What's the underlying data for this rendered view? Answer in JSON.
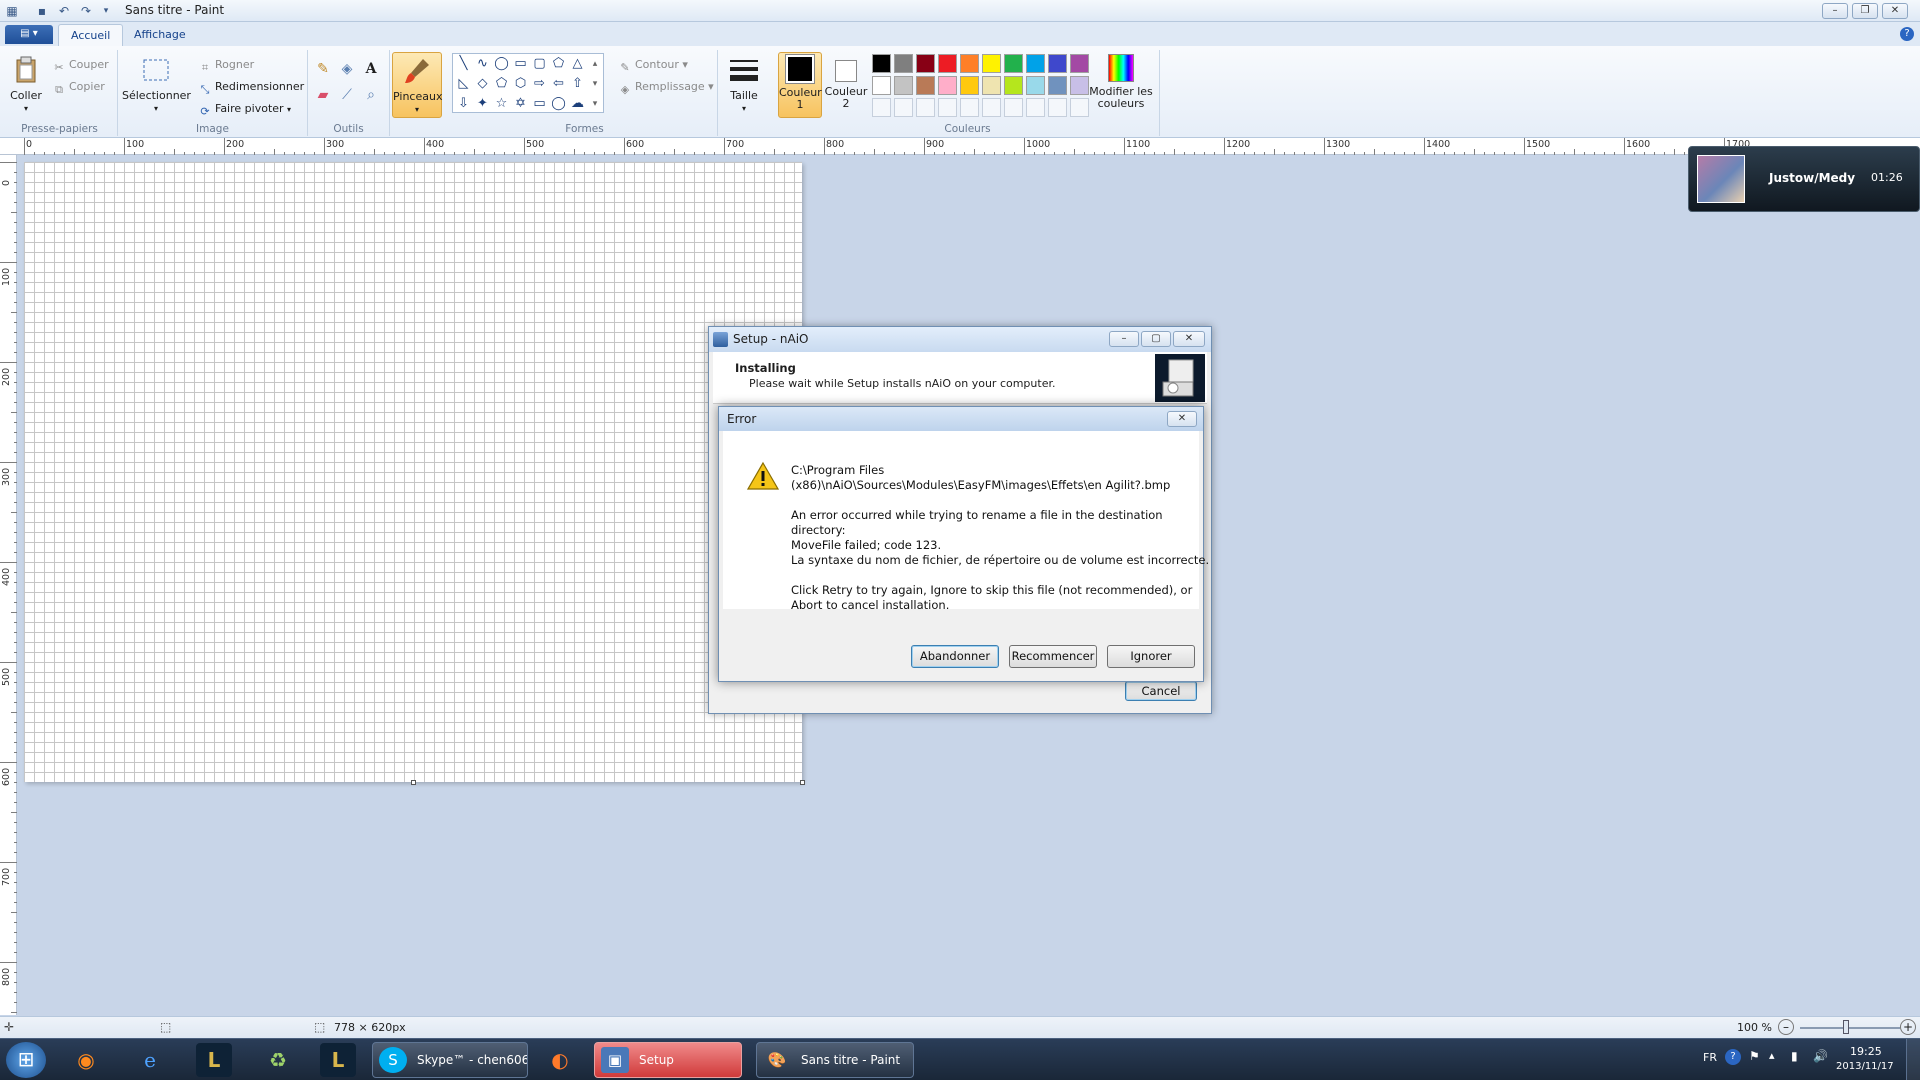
{
  "window": {
    "title": "Sans titre - Paint"
  },
  "ribbon": {
    "file_label": "▤ ▾",
    "tabs": [
      "Accueil",
      "Affichage"
    ],
    "clipboard": {
      "paste": "Coller",
      "cut": "Couper",
      "copy": "Copier",
      "group": "Presse-papiers"
    },
    "image": {
      "select": "Sélectionner",
      "crop": "Rogner",
      "resize": "Redimensionner",
      "rotate": "Faire pivoter",
      "group": "Image"
    },
    "tools": {
      "group": "Outils"
    },
    "brushes": {
      "label": "Pinceaux"
    },
    "shapes": {
      "outline": "Contour",
      "fill": "Remplissage",
      "group": "Formes"
    },
    "size": {
      "label": "Taille"
    },
    "colors": {
      "color1_line1": "Couleur",
      "color1_line2": "1",
      "color2_line1": "Couleur",
      "color2_line2": "2",
      "edit_line1": "Modifier les",
      "edit_line2": "couleurs",
      "group": "Couleurs",
      "palette_row1": [
        "#000000",
        "#7f7f7f",
        "#880015",
        "#ed1c24",
        "#ff7f27",
        "#fff200",
        "#22b14c",
        "#00a2e8",
        "#3f48cc",
        "#a349a4"
      ],
      "palette_row2": [
        "#ffffff",
        "#c3c3c3",
        "#b97a57",
        "#ffaec9",
        "#ffc90e",
        "#efe4b0",
        "#b5e61d",
        "#99d9ea",
        "#7092be",
        "#c8bfe7"
      ]
    }
  },
  "rulers": {
    "h": [
      "0",
      "100",
      "200",
      "300",
      "400",
      "500",
      "600",
      "700",
      "800",
      "900",
      "1000",
      "1100",
      "1200",
      "1300",
      "1400",
      "1500",
      "1600",
      "1700"
    ],
    "v": [
      "0",
      "100",
      "200",
      "300",
      "400",
      "500",
      "600",
      "700",
      "800"
    ]
  },
  "music": {
    "track": "Justow/Medy",
    "time": "01:26"
  },
  "setup": {
    "title": "Setup - nAiO",
    "heading": "Installing",
    "subheading": "Please wait while Setup installs nAiO on your computer.",
    "cancel": "Cancel"
  },
  "error": {
    "title": "Error",
    "path_line1": "C:\\Program Files",
    "path_line2": "(x86)\\nAiO\\Sources\\Modules\\EasyFM\\images\\Effets\\en Agilit?.bmp",
    "msg1": "An error occurred while trying to rename a file in the destination",
    "msg2": "directory:",
    "msg3": "MoveFile failed; code 123.",
    "msg4": "La syntaxe du nom de fichier, de répertoire ou de volume est incorrecte.",
    "msg5": "Click Retry to try again, Ignore to skip this file (not recommended), or",
    "msg6": "Abort to cancel installation.",
    "abort": "Abandonner",
    "retry": "Recommencer",
    "ignore": "Ignorer"
  },
  "status": {
    "dimensions": "778 × 620px",
    "zoom": "100 %"
  },
  "taskbar": {
    "skype": "Skype™ - chen606...",
    "setup": "Setup",
    "paint": "Sans titre - Paint",
    "lang": "FR",
    "time": "19:25",
    "date": "2013/11/17"
  }
}
